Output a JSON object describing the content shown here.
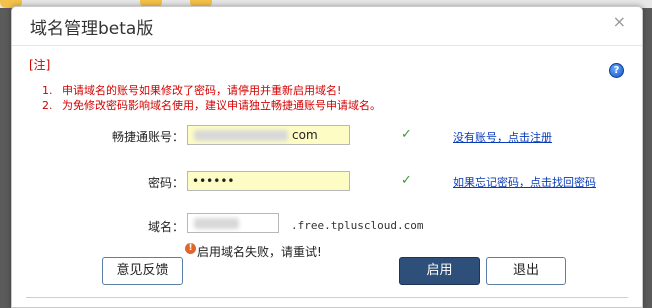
{
  "dialog": {
    "title": "域名管理beta版",
    "close_glyph": "×",
    "help_glyph": "?"
  },
  "notes": {
    "tag": "[注]",
    "items": [
      {
        "num": "1.",
        "text": "申请域名的账号如果修改了密码，请停用并重新启用域名!"
      },
      {
        "num": "2.",
        "text": "为免修改密码影响域名使用，建议申请独立畅捷通账号申请域名。"
      }
    ]
  },
  "form": {
    "account_label": "畅捷通账号：",
    "account_value_visible": "com",
    "account_check": "✓",
    "account_link": "没有账号，点击注册",
    "password_label": "密码：",
    "password_value": "••••••",
    "password_check": "✓",
    "password_link": "如果忘记密码，点击找回密码",
    "domain_label": "域名：",
    "domain_suffix": ".free.tpluscloud.com",
    "error_glyph": "!",
    "error_text": "启用域名失败，请重试!"
  },
  "buttons": {
    "feedback": "意见反馈",
    "enable": "启用",
    "exit": "退出"
  },
  "colors": {
    "note_red": "#d40000",
    "primary_button": "#2d4f7a",
    "link_blue": "#0a3bb7",
    "field_yellow": "#fefcc5"
  }
}
